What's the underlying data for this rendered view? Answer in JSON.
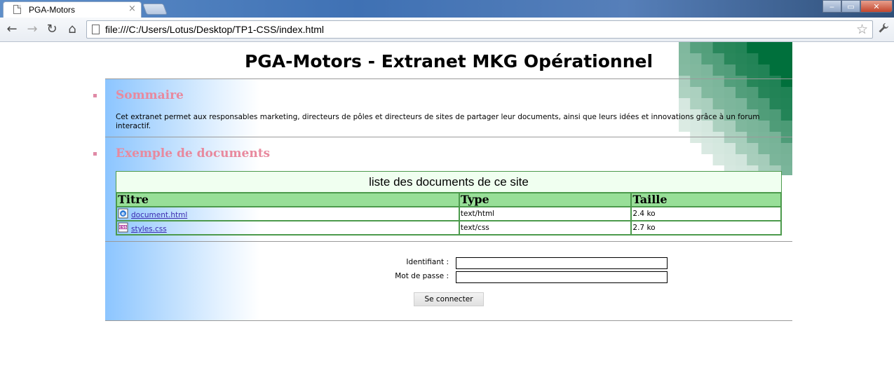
{
  "browser": {
    "tab_title": "PGA-Motors",
    "tab_close": "×",
    "url": "file:///C:/Users/Lotus/Desktop/TP1-CSS/index.html",
    "window_buttons": {
      "minimize": "‒",
      "maximize": "▭",
      "close": "✕"
    },
    "nav": {
      "back": "←",
      "forward": "→",
      "reload": "↻",
      "home": "⌂"
    },
    "star": "☆",
    "wrench": "🔧"
  },
  "page": {
    "title": "PGA-Motors - Extranet MKG Opérationnel",
    "sections": [
      {
        "heading": "Sommaire",
        "text": "Cet extranet permet aux responsables marketing, directeurs de pôles et directeurs de sites de partager leur documents, ainsi que leurs idées et innovations grâce à un forum interactif."
      },
      {
        "heading": "Exemple de documents"
      }
    ],
    "table": {
      "caption": "liste des documents de ce site",
      "headers": [
        "Titre",
        "Type",
        "Taille"
      ],
      "rows": [
        {
          "title": "document.html",
          "type": "text/html",
          "size": "2.4 ko",
          "icon": "html-file-icon"
        },
        {
          "title": "styles.css",
          "type": "text/css",
          "size": "2.7 ko",
          "icon": "css-file-icon"
        }
      ]
    },
    "login": {
      "id_label": "Identifiant :",
      "id_value": "",
      "password_label": "Mot de passe :",
      "password_value": "",
      "submit": "Se connecter"
    }
  },
  "colors": {
    "heading": "#e8899e",
    "table_header": "#98df98",
    "caption_bg": "#f0fff0",
    "table_border": "#4c9a4c",
    "side_gradient": "#8cc5ff"
  }
}
